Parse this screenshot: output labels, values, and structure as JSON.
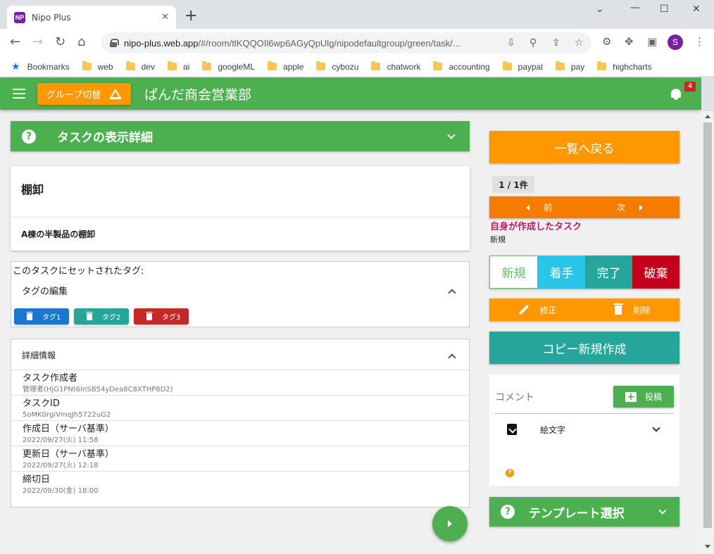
{
  "browser": {
    "tab_title": "Nipo Plus",
    "favicon_text": "NP",
    "tab_close": "✕",
    "new_tab": "+",
    "url_host": "nipo-plus.web.app",
    "url_path": "/#/room/tlKQQOIl6wp6AGyQpUlg/nipodefaultgroup/green/task/...",
    "profile_initial": "S",
    "bookmarks": [
      "Bookmarks",
      "web",
      "dev",
      "ai",
      "googleML",
      "apple",
      "cybozu",
      "chatwork",
      "accounting",
      "paypal",
      "pay",
      "highcharts"
    ],
    "icons": [
      "back-arrow-icon",
      "forward-arrow-icon",
      "reload-icon",
      "home-icon",
      "lock-icon",
      "install-icon",
      "zoom-icon",
      "share-icon",
      "bookmark-star-icon",
      "extension-icon",
      "puzzle-icon",
      "sidepanel-icon",
      "kebab-menu-icon"
    ]
  },
  "appbar": {
    "group_button": "グループ切替",
    "title": "ぱんだ商会営業部",
    "notification_count": "4"
  },
  "detail_header": {
    "title": "タスクの表示詳細"
  },
  "task": {
    "title": "棚卸",
    "description": "A棟の半製品の棚卸"
  },
  "tags": {
    "caption": "このタスクにセットされたタグ:",
    "edit_label": "タグの編集",
    "items": [
      {
        "label": "タグ1",
        "color": "#1976d2"
      },
      {
        "label": "タグ2",
        "color": "#26a69a"
      },
      {
        "label": "タグ3",
        "color": "#c62828"
      }
    ]
  },
  "details": {
    "title": "詳細情報",
    "rows": [
      {
        "label": "タスク作成者",
        "value": "管理者(HjG1PNt6InSB54yDea8C8XTHP8D2)"
      },
      {
        "label": "タスクID",
        "value": "5oMK0rgiVmqJh5722uG2"
      },
      {
        "label": "作成日（サーバ基準）",
        "value": "2022/09/27(火) 11:58"
      },
      {
        "label": "更新日（サーバ基準）",
        "value": "2022/09/27(火) 12:18"
      },
      {
        "label": "締切日",
        "value": "2022/09/30(金) 18:00"
      }
    ]
  },
  "sidebar": {
    "back_button": "一覧へ戻る",
    "count": "1 / 1件",
    "prev": "前",
    "next": "次",
    "owner_note": "自身が作成したタスク",
    "status_text": "新規",
    "statuses": [
      {
        "label": "新規",
        "color": "#ffffff"
      },
      {
        "label": "着手",
        "color": "#29c6ea"
      },
      {
        "label": "完了",
        "color": "#26a69a"
      },
      {
        "label": "破棄",
        "color": "#c2001b"
      }
    ],
    "edit": "修正",
    "delete": "削除",
    "copy_button": "コピー新規作成",
    "comment_label": "コメント",
    "post_button": "投稿",
    "emoji_label": "絵文字",
    "template_title": "テンプレート選択"
  }
}
